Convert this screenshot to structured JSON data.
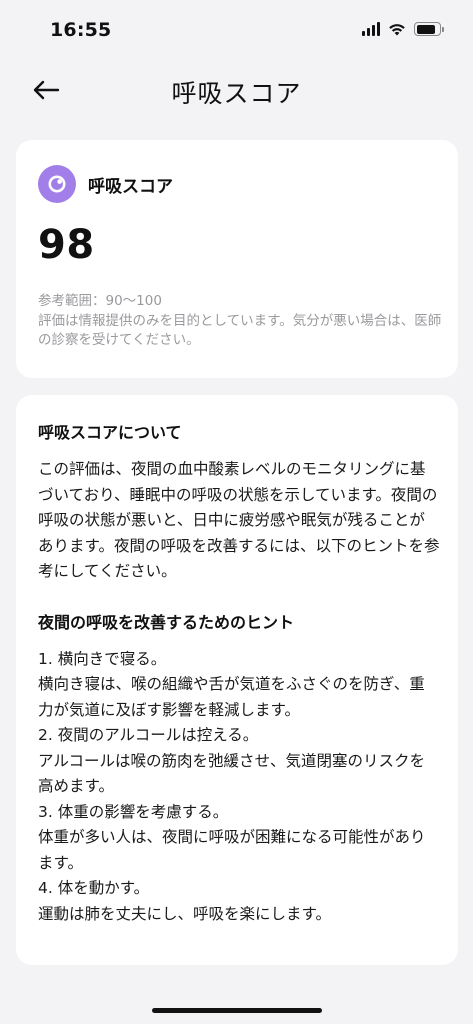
{
  "status": {
    "time": "16:55"
  },
  "nav": {
    "title": "呼吸スコア"
  },
  "score_card": {
    "label": "呼吸スコア",
    "value": "98",
    "reference_range": "参考範囲：90～100",
    "disclaimer": "評価は情報提供のみを目的としています。気分が悪い場合は、医師の診察を受けてください。"
  },
  "info_card": {
    "about_heading": "呼吸スコアについて",
    "about_text": "この評価は、夜間の血中酸素レベルのモニタリングに基づいており、睡眠中の呼吸の状態を示しています。夜間の呼吸の状態が悪いと、日中に疲労感や眠気が残ることがあります。夜間の呼吸を改善するには、以下のヒントを参考にしてください。",
    "tips_heading": "夜間の呼吸を改善するためのヒント",
    "tips": [
      {
        "title": "1. 横向きで寝る。",
        "text": "横向き寝は、喉の組織や舌が気道をふさぐのを防ぎ、重力が気道に及ぼす影響を軽減します。"
      },
      {
        "title": "2. 夜間のアルコールは控える。",
        "text": "アルコールは喉の筋肉を弛緩させ、気道閉塞のリスクを高めます。"
      },
      {
        "title": "3. 体重の影響を考慮する。",
        "text": "体重が多い人は、夜間に呼吸が困難になる可能性があります。"
      },
      {
        "title": "4. 体を動かす。",
        "text": "運動は肺を丈夫にし、呼吸を楽にします。"
      }
    ]
  },
  "colors": {
    "accent": "#a27ee8",
    "background": "#f3f3f5",
    "card": "#ffffff",
    "muted_text": "#9a9a9e"
  },
  "icons": {
    "back": "arrow-left-icon",
    "score": "moon-icon"
  }
}
